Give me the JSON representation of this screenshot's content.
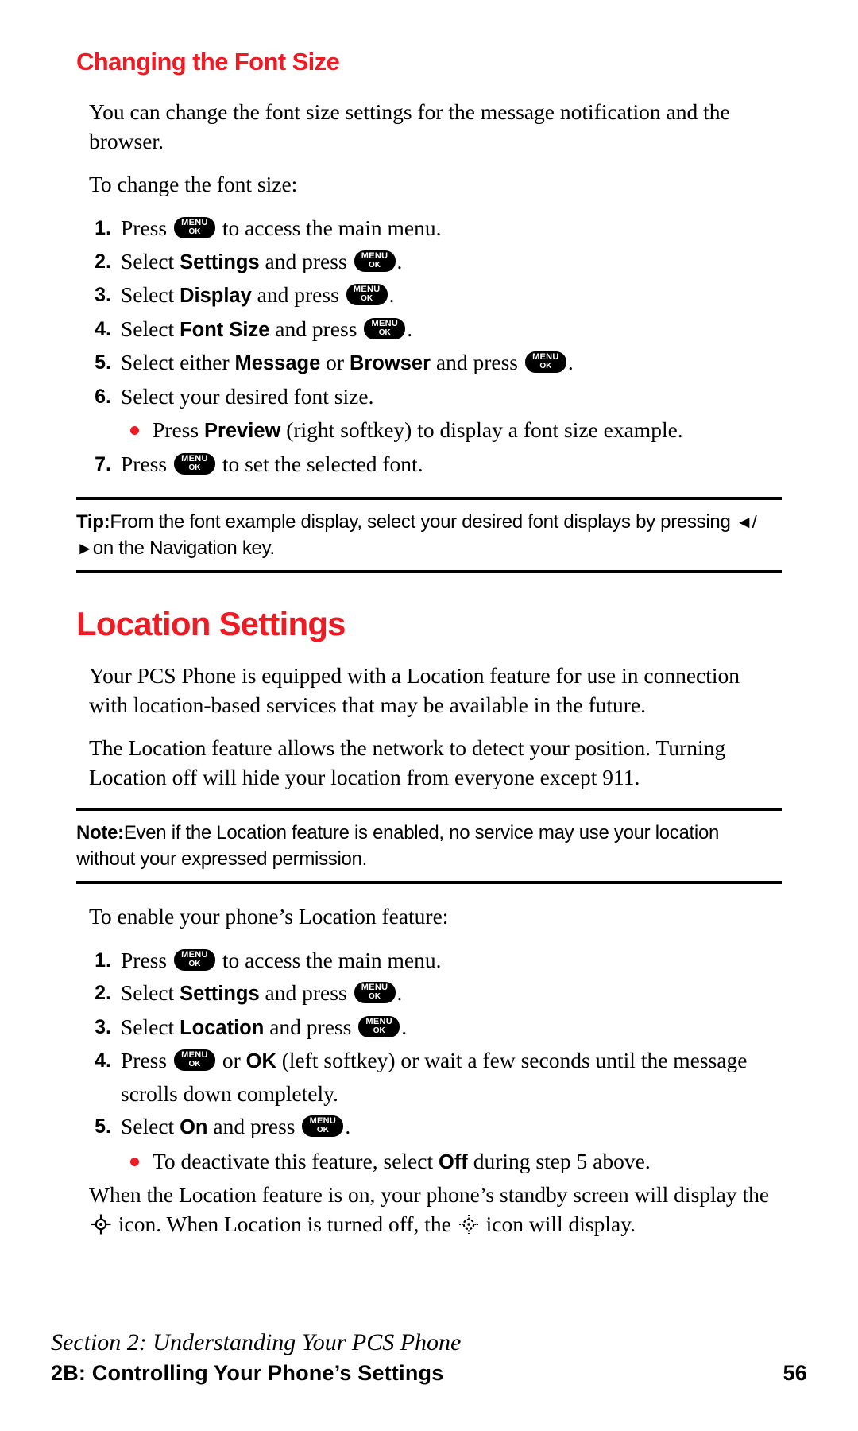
{
  "page": {
    "number": "56",
    "footer_italic": "Section 2: Understanding Your PCS Phone",
    "footer_bold": "2B: Controlling Your Phone’s Settings",
    "accent_color": "#ED1C24"
  },
  "keys": {
    "menu_top": "MENU",
    "menu_bottom": "OK"
  },
  "sections": [
    {
      "id": "font-size",
      "heading": "Changing the Font Size",
      "level": "h2",
      "paragraphs": [
        "You can change the font size settings for the message notification and the browser.",
        "To change the font size:"
      ],
      "steps": [
        {
          "num": "1.",
          "pre": "Press ",
          "key": true,
          "post": " to access the main menu."
        },
        {
          "num": "2.",
          "pre": "Select ",
          "bold1": "Settings",
          "mid": " and press ",
          "key": true,
          "post": "."
        },
        {
          "num": "3.",
          "pre": "Select ",
          "bold1": "Display",
          "mid": " and press ",
          "key": true,
          "post": "."
        },
        {
          "num": "4.",
          "pre": "Select ",
          "bold1": "Font Size",
          "mid": " and press ",
          "key": true,
          "post": "."
        },
        {
          "num": "5.",
          "pre": "Select either ",
          "bold1": "Message",
          "mid1": " or ",
          "bold2": "Browser",
          "mid": " and press ",
          "key": true,
          "post": "."
        },
        {
          "num": "6.",
          "pre": "Select your desired font size.",
          "key": false,
          "post": ""
        },
        {
          "num": "7.",
          "pre": "Press ",
          "key": true,
          "post": " to set the selected font."
        }
      ],
      "bullet": {
        "pre": "Press ",
        "bold1": "Preview",
        "post": " (right softkey) to display a font size example."
      },
      "callout": {
        "type": "Tip:",
        "text_a": "From the font example display, select your desired font displays by pressing",
        "arrows": "◄/►",
        "text_b": "on the Navigation key."
      }
    },
    {
      "id": "location-settings",
      "heading": "Location Settings",
      "level": "h1",
      "paragraphs": [
        "Your PCS Phone is equipped with a Location feature for use in connection with location-based services that may be available in the future.",
        "The Location feature allows the network to detect your position. Turning Location off will hide your location from everyone except 911."
      ],
      "callout": {
        "type": "Note:",
        "text_a": "Even if the Location feature is enabled, no service may use your location without your expressed permission."
      },
      "intro_after_note": "To enable your phone’s Location feature:",
      "steps": [
        {
          "num": "1.",
          "pre": "Press ",
          "key": true,
          "post": " to access the main menu."
        },
        {
          "num": "2.",
          "pre": "Select ",
          "bold1": "Settings",
          "mid": " and press ",
          "key": true,
          "post": "."
        },
        {
          "num": "3.",
          "pre": "Select ",
          "bold1": "Location",
          "mid": " and press ",
          "key": true,
          "post": "."
        },
        {
          "num": "4.",
          "pre": "Press ",
          "key": true,
          "mid1": " or ",
          "bold2": "OK",
          "post": " (left softkey) or wait a few seconds until the message scrolls down completely."
        },
        {
          "num": "5.",
          "pre": "Select ",
          "bold1": "On",
          "mid": " and press ",
          "key": true,
          "post": "."
        }
      ],
      "bullet": {
        "pre": "To deactivate this feature, select ",
        "bold1": "Off",
        "post": " during step 5 above."
      },
      "closing_a": "When the Location feature is on, your phone’s standby screen will display the ",
      "closing_b": " icon. When Location is turned off, the ",
      "closing_c": " icon will display."
    }
  ]
}
